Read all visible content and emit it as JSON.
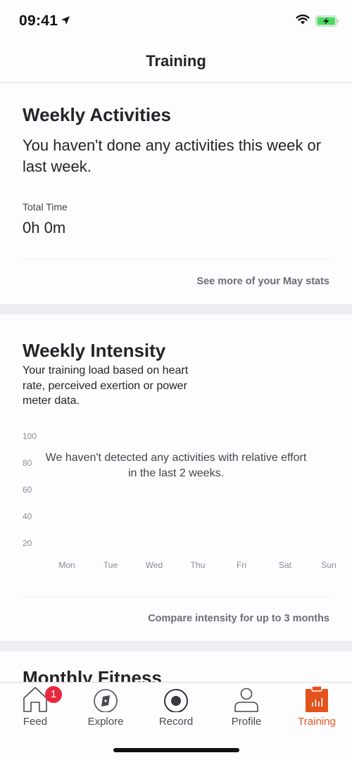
{
  "status_bar": {
    "time": "09:41",
    "icons": [
      "location-arrow-icon",
      "wifi-icon",
      "battery-charging-icon"
    ],
    "battery_color": "#4cd964"
  },
  "nav": {
    "title": "Training"
  },
  "weekly_activities": {
    "title": "Weekly Activities",
    "message": "You haven't done any activities this week or last week.",
    "total_time_label": "Total Time",
    "total_time_value": "0h 0m",
    "link": "See more of your May stats"
  },
  "weekly_intensity": {
    "title": "Weekly Intensity",
    "description": "Your training load based on heart rate, perceived exertion or power meter data.",
    "empty_message": "We haven't detected any activities with relative effort in the last 2 weeks.",
    "link": "Compare intensity for up to 3 months"
  },
  "chart_data": {
    "type": "bar",
    "title": "Weekly Intensity",
    "categories": [
      "Mon",
      "Tue",
      "Wed",
      "Thu",
      "Fri",
      "Sat",
      "Sun"
    ],
    "values": [],
    "y_ticks": [
      "100",
      "80",
      "60",
      "40",
      "20"
    ],
    "ylim": [
      0,
      100
    ],
    "grid": false,
    "annotation": "We haven't detected any activities with relative effort in the last 2 weeks."
  },
  "monthly_fitness": {
    "title": "Monthly Fitness"
  },
  "tab_bar": {
    "accent_color": "#e3531d",
    "items": [
      {
        "label": "Feed",
        "icon": "home-icon",
        "badge": "1"
      },
      {
        "label": "Explore",
        "icon": "compass-icon"
      },
      {
        "label": "Record",
        "icon": "record-icon"
      },
      {
        "label": "Profile",
        "icon": "person-icon"
      },
      {
        "label": "Training",
        "icon": "training-clipboard-icon",
        "active": true
      }
    ]
  }
}
